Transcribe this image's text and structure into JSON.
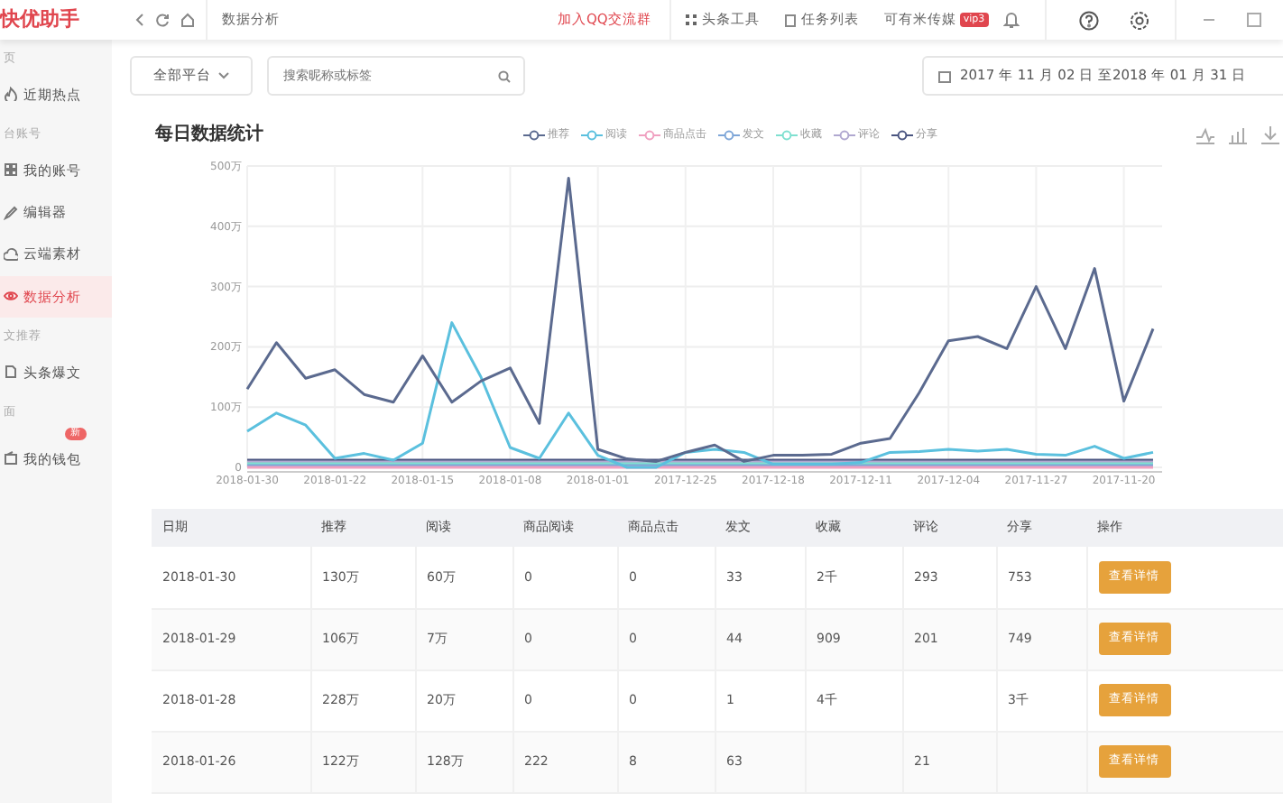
{
  "app": {
    "logo": "快优助手"
  },
  "topbar": {
    "page_title": "数据分析",
    "join_group": "加入QQ交流群",
    "tools": "头条工具",
    "tasks": "任务列表",
    "account": "可有米传媒",
    "vip": "vip3"
  },
  "sidebar": {
    "groups": [
      {
        "title": "页",
        "items": [
          {
            "label": "近期热点",
            "selected": false
          }
        ]
      },
      {
        "title": "台账号",
        "items": [
          {
            "label": "我的账号",
            "selected": false
          },
          {
            "label": "编辑器",
            "selected": false
          },
          {
            "label": "云端素材",
            "selected": false
          },
          {
            "label": "数据分析",
            "selected": true
          }
        ]
      },
      {
        "title": "文推荐",
        "items": [
          {
            "label": "头条爆文",
            "selected": false
          }
        ]
      },
      {
        "title": "面",
        "items": [
          {
            "label": "我的钱包",
            "selected": false,
            "badge": "新"
          }
        ]
      }
    ]
  },
  "filters": {
    "platform": "全部平台",
    "search_placeholder": "搜索昵称或标签",
    "date_range": "2017 年 11 月 02 日 至2018 年 01 月 31 日"
  },
  "chart": {
    "title": "每日数据统计",
    "chart_data": {
      "type": "line",
      "categories": [
        "2018-01-30",
        null,
        null,
        "2018-01-22",
        null,
        null,
        "2018-01-15",
        null,
        null,
        "2018-01-08",
        null,
        null,
        "2018-01-01",
        null,
        null,
        "2017-12-25",
        null,
        null,
        "2017-12-18",
        null,
        null,
        "2017-12-11",
        null,
        null,
        "2017-12-04",
        null,
        null,
        "2017-11-27",
        null,
        null,
        "2017-11-20",
        null
      ],
      "ylim": [
        0,
        500
      ],
      "grid": true,
      "yticks": [
        {
          "value": 0,
          "label": "0"
        },
        {
          "value": 100,
          "label": "100万"
        },
        {
          "value": 200,
          "label": "200万"
        },
        {
          "value": 300,
          "label": "300万"
        },
        {
          "value": 400,
          "label": "400万"
        },
        {
          "value": 500,
          "label": "500万"
        }
      ],
      "series": [
        {
          "name": "推荐",
          "color": "#5b6a8f",
          "values": [
            130,
            207,
            148,
            162,
            121,
            108,
            185,
            108,
            143,
            165,
            73,
            480,
            30,
            14,
            10,
            25,
            37,
            10,
            20,
            20,
            22,
            40,
            48,
            124,
            210,
            217,
            197,
            300,
            197,
            330,
            110,
            230
          ]
        },
        {
          "name": "阅读",
          "color": "#5bc0de",
          "values": [
            60,
            90,
            70,
            15,
            23,
            12,
            40,
            240,
            150,
            33,
            15,
            90,
            20,
            0,
            0,
            25,
            30,
            25,
            5,
            5,
            5,
            8,
            25,
            26,
            30,
            27,
            30,
            22,
            20,
            35,
            15,
            25
          ]
        },
        {
          "name": "商品点击",
          "color": "#f0a0c0",
          "values": [
            0,
            0,
            0,
            0,
            0,
            0,
            0,
            0,
            0,
            0,
            0,
            0,
            0,
            0,
            0,
            0,
            0,
            0,
            0,
            0,
            0,
            0,
            0,
            0,
            0,
            0,
            0,
            0,
            0,
            0,
            0,
            0
          ]
        },
        {
          "name": "发文",
          "color": "#7ea6d8",
          "values": [
            3,
            3,
            3,
            3,
            3,
            3,
            3,
            3,
            3,
            3,
            3,
            3,
            3,
            3,
            3,
            3,
            3,
            3,
            3,
            3,
            3,
            3,
            3,
            3,
            3,
            3,
            3,
            3,
            3,
            3,
            3,
            3
          ]
        },
        {
          "name": "收藏",
          "color": "#7fe0d0",
          "values": [
            6,
            6,
            6,
            6,
            6,
            6,
            6,
            6,
            6,
            6,
            6,
            6,
            6,
            6,
            6,
            6,
            6,
            6,
            6,
            6,
            6,
            6,
            6,
            6,
            6,
            6,
            6,
            6,
            6,
            6,
            6,
            6
          ]
        },
        {
          "name": "评论",
          "color": "#b0a8d0",
          "values": [
            9,
            9,
            9,
            9,
            9,
            9,
            9,
            9,
            9,
            9,
            9,
            9,
            9,
            9,
            9,
            9,
            9,
            9,
            9,
            9,
            9,
            9,
            9,
            9,
            9,
            9,
            9,
            9,
            9,
            9,
            9,
            9
          ]
        },
        {
          "name": "分享",
          "color": "#4a5580",
          "values": [
            12,
            12,
            12,
            12,
            12,
            12,
            12,
            12,
            12,
            12,
            12,
            12,
            12,
            12,
            12,
            12,
            12,
            12,
            12,
            12,
            12,
            12,
            12,
            12,
            12,
            12,
            12,
            12,
            12,
            12,
            12,
            12
          ]
        }
      ]
    }
  },
  "table": {
    "columns": [
      "日期",
      "推荐",
      "阅读",
      "商品阅读",
      "商品点击",
      "发文",
      "收藏",
      "评论",
      "分享",
      "操作"
    ],
    "rows": [
      {
        "cells": [
          "2018-01-30",
          "130万",
          "60万",
          "0",
          "0",
          "33",
          "2千",
          "293",
          "753"
        ],
        "action": "查看详情"
      },
      {
        "cells": [
          "2018-01-29",
          "106万",
          "7万",
          "0",
          "0",
          "44",
          "909",
          "201",
          "749"
        ],
        "action": "查看详情"
      },
      {
        "cells": [
          "2018-01-28",
          "228万",
          "20万",
          "0",
          "0",
          "1",
          "4千",
          null,
          "3千"
        ],
        "action": "查看详情"
      },
      {
        "cells": [
          "2018-01-26",
          "122万",
          "128万",
          "222",
          "8",
          "63",
          null,
          "21",
          null
        ],
        "action": "查看详情"
      }
    ]
  }
}
